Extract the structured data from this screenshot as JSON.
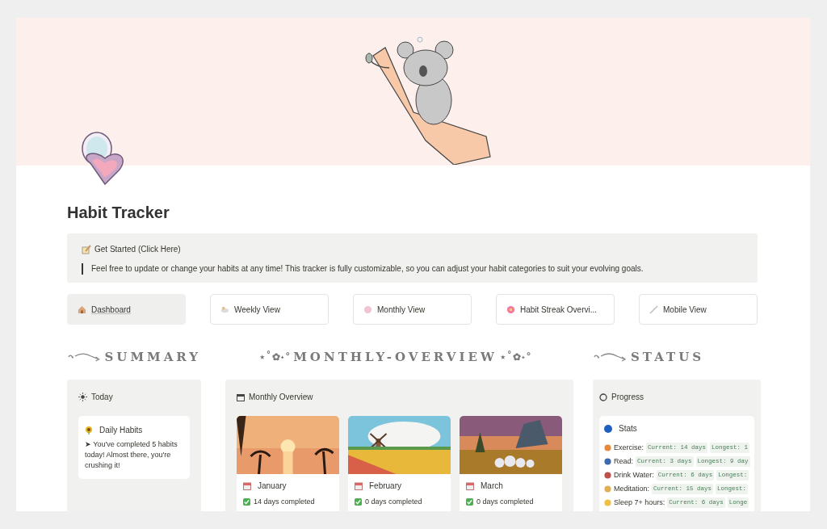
{
  "title": "Habit Tracker",
  "callout": {
    "title": "Get Started (Click Here)",
    "text": "Feel free to update or change your habits at any time! This tracker is fully customizable, so you can adjust your habit categories to suit your evolving goals."
  },
  "nav_buttons": [
    {
      "label": "Dashboard",
      "selected": true
    },
    {
      "label": "Weekly View",
      "selected": false
    },
    {
      "label": "Monthly View",
      "selected": false
    },
    {
      "label": "Habit Streak Overvi...",
      "selected": false
    },
    {
      "label": "Mobile View",
      "selected": false
    }
  ],
  "summary": {
    "heading": "SUMMARY",
    "panel_title": "Today",
    "card": {
      "title": "Daily Habits",
      "text": "➤ You've completed 5 habits today! Almost there, you're crushing it!"
    }
  },
  "monthly": {
    "heading_left": "⋆˚✿˖°",
    "heading": "MONTHLY-OVERVIEW",
    "heading_right": "⋆˚✿˖°",
    "panel_title": "Monthly Overview",
    "months": [
      {
        "name": "January",
        "completed": "14 days completed"
      },
      {
        "name": "February",
        "completed": "0 days completed"
      },
      {
        "name": "March",
        "completed": "0 days completed"
      }
    ]
  },
  "status": {
    "heading": "STATUS",
    "panel_title": "Progress",
    "card_title": "Stats",
    "stats": [
      {
        "label": "Exercise:",
        "current": "Current: 14 days",
        "longest": "Longest: 1"
      },
      {
        "label": "Read:",
        "current": "Current: 3 days",
        "longest": "Longest: 9 day"
      },
      {
        "label": "Drink Water:",
        "current": "Current: 6 days",
        "longest": "Longest:"
      },
      {
        "label": "Meditation:",
        "current": "Current: 15 days",
        "longest": "Longest:"
      },
      {
        "label": "Sleep 7+ hours:",
        "current": "Current: 6 days",
        "longest": "Longe"
      }
    ]
  }
}
